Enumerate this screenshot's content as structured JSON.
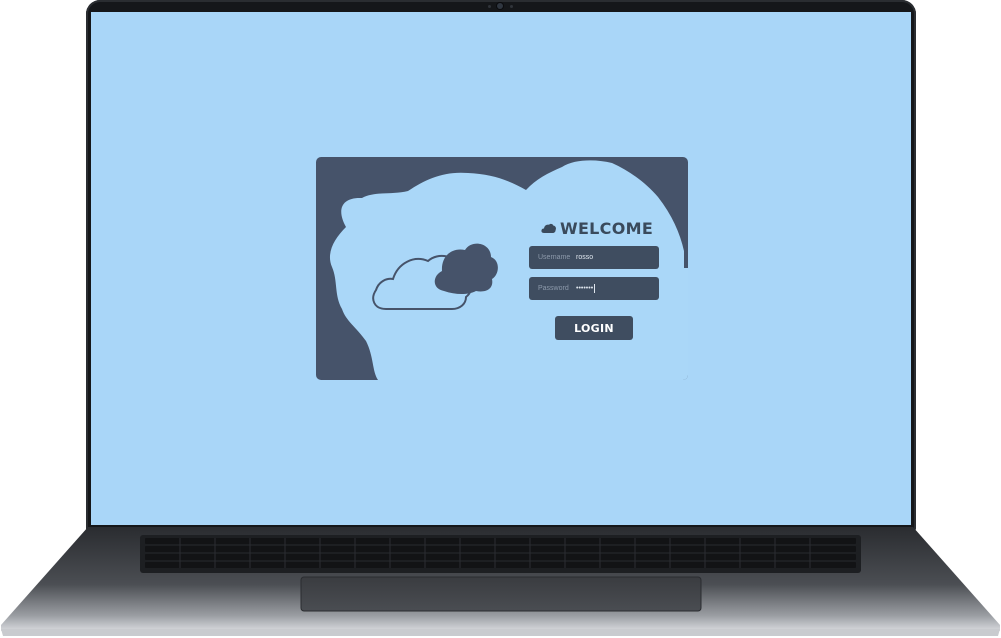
{
  "screen": {
    "background_color": "#a9d6f8"
  },
  "login": {
    "title": "WELCOME",
    "title_icon": "cloud-icon",
    "username_label": "Username",
    "username_value": "rosso",
    "password_label": "Password",
    "password_value": "•••••••",
    "button_label": "LOGIN",
    "accent_color": "#3f4d60",
    "illustration_icons": [
      "cloud-outline-icon",
      "cloud-filled-icon"
    ]
  }
}
